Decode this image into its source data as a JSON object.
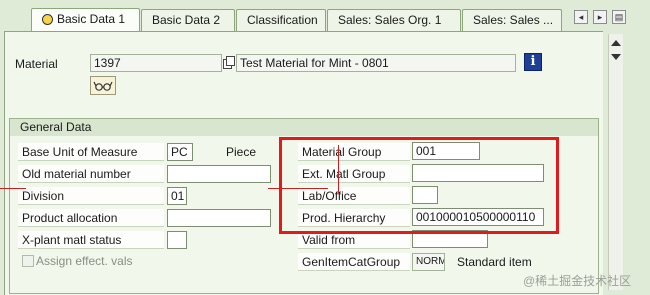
{
  "tabs": [
    {
      "label": "Basic Data 1",
      "active": true
    },
    {
      "label": "Basic Data 2"
    },
    {
      "label": "Classification"
    },
    {
      "label": "Sales: Sales Org. 1"
    },
    {
      "label": "Sales: Sales ..."
    }
  ],
  "tab_nav": {
    "prev": "◂",
    "next": "▸",
    "list": "▤"
  },
  "header": {
    "material_label": "Material",
    "material_value": "1397",
    "material_desc": "Test Material for Mint - 0801",
    "info_icon_text": "i"
  },
  "general_data": {
    "title": "General Data",
    "base_unit_label": "Base Unit of Measure",
    "base_unit_value": "PC",
    "base_unit_text": "Piece",
    "old_material_label": "Old material number",
    "old_material_value": "",
    "division_label": "Division",
    "division_value": "01",
    "product_allocation_label": "Product allocation",
    "product_allocation_value": "",
    "xplant_status_label": "X-plant matl status",
    "xplant_status_value": "",
    "assign_effect_label": "Assign effect. vals",
    "material_group_label": "Material Group",
    "material_group_value": "001",
    "ext_matl_group_label": "Ext. Matl Group",
    "ext_matl_group_value": "",
    "lab_office_label": "Lab/Office",
    "lab_office_value": "",
    "prod_hierarchy_label": "Prod. Hierarchy",
    "prod_hierarchy_value": "001000010500000110",
    "valid_from_label": "Valid from",
    "valid_from_value": "",
    "gen_item_cat_label": "GenItemCatGroup",
    "gen_item_cat_value": "NORM",
    "gen_item_cat_text": "Standard item"
  },
  "watermark": "@稀土掘金技术社区",
  "colors": {
    "highlight": "#e01b1b",
    "tab_bg": "#eef4e8",
    "content_bg": "#f2f7ec"
  }
}
